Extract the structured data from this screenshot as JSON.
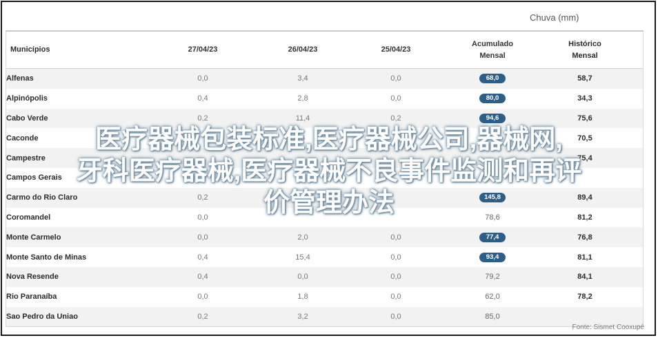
{
  "header": {
    "group_label": "Chuva (mm)"
  },
  "table": {
    "columns": [
      {
        "label": "Municípios"
      },
      {
        "label": "27/04/23"
      },
      {
        "label": "26/04/23"
      },
      {
        "label": "25/04/23"
      },
      {
        "line1": "Acumulado",
        "line2": "Mensal"
      },
      {
        "line1": "Histórico",
        "line2": "Mensal"
      }
    ],
    "rows": [
      {
        "name": "Alfenas",
        "d27": "0,0",
        "d26": "3,4",
        "d25": "0,0",
        "acc": "68,0",
        "acc_badge": true,
        "hist": "58,7"
      },
      {
        "name": "Alpinópolis",
        "d27": "0,4",
        "d26": "2,8",
        "d25": "0,0",
        "acc": "80,0",
        "acc_badge": true,
        "hist": "34,3"
      },
      {
        "name": "Cabo Verde",
        "d27": "0,2",
        "d26": "11,4",
        "d25": "0,2",
        "acc": "94,6",
        "acc_badge": true,
        "hist": "75,6"
      },
      {
        "name": "Caconde",
        "d27": "",
        "d26": "6",
        "d25": "",
        "acc": "",
        "acc_badge": true,
        "hist": "70,5"
      },
      {
        "name": "Campestre",
        "d27": "",
        "d26": "",
        "d25": "",
        "acc": "",
        "acc_badge": true,
        "hist": "75,4"
      },
      {
        "name": "Campos Gerais",
        "d27": "",
        "d26": "",
        "d25": "",
        "acc": "",
        "acc_badge": true,
        "hist": ""
      },
      {
        "name": "Carmo do Rio Claro",
        "d27": "0,2",
        "d26": "",
        "d25": "",
        "acc": "145,8",
        "acc_badge": true,
        "hist": "89,4"
      },
      {
        "name": "Coromandel",
        "d27": "0,0",
        "d26": "",
        "d25": "",
        "acc": "78,6",
        "acc_badge": false,
        "hist": "81,2"
      },
      {
        "name": "Monte Carmelo",
        "d27": "0,0",
        "d26": "2,0",
        "d25": "0,0",
        "acc": "77,4",
        "acc_badge": true,
        "hist": "76,8"
      },
      {
        "name": "Monte Santo de Minas",
        "d27": "0,4",
        "d26": "15,4",
        "d25": "0,0",
        "acc": "93,4",
        "acc_badge": true,
        "hist": "81,1"
      },
      {
        "name": "Nova Resende",
        "d27": "0,4",
        "d26": "0,0",
        "d25": "0,0",
        "acc": "79,2",
        "acc_badge": false,
        "hist": "84,1"
      },
      {
        "name": "Rio Paranaíba",
        "d27": "0,0",
        "d26": "1,8",
        "d25": "0,0",
        "acc": "62,0",
        "acc_badge": false,
        "hist": "78,2"
      },
      {
        "name": "Sao Pedro da Uniao",
        "d27": "0,2",
        "d26": "3,2",
        "d25": "0,0",
        "acc": "85,0",
        "acc_badge": false,
        "hist": ""
      }
    ]
  },
  "footer": {
    "source": "Fonte: Sismet Cooxupé"
  },
  "overlay": {
    "line1": "医疗器械包装标准,医疗器械公司,器械网,",
    "line2": "牙科医疗器械,医疗器械不良事件监测和再评",
    "line3": "价管理办法"
  },
  "colors": {
    "badge": "#2b5f8a",
    "overlay_text": "#ffffff"
  }
}
